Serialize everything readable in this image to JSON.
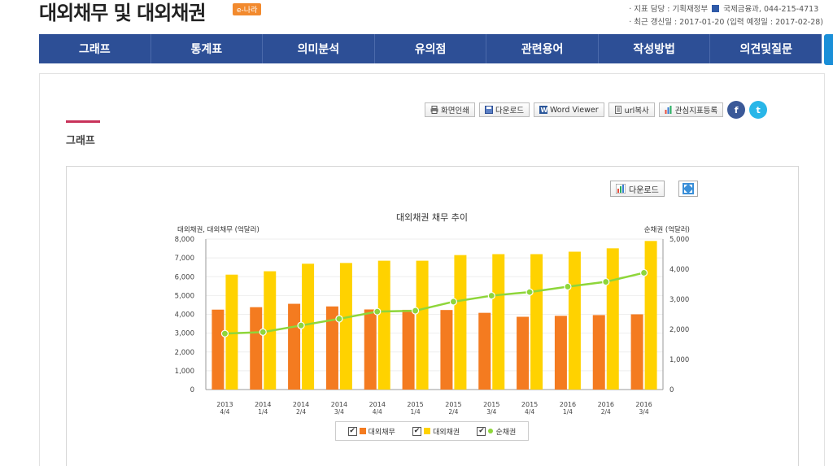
{
  "header": {
    "title": "대외채무 및 대외채권",
    "badge": "e-나라",
    "meta_line1": "· 지표 담당 : 기획재정부",
    "meta_dept": "국제금융과, 044-215-4713",
    "meta_line2": "· 최근 갱신일 : 2017-01-20 (입력 예정일 : 2017-02-28)"
  },
  "nav": [
    "그래프",
    "통계표",
    "의미분석",
    "유의점",
    "관련용어",
    "작성방법",
    "의견및질문"
  ],
  "toolbar": {
    "print": "화면인쇄",
    "download": "다운로드",
    "word": "Word Viewer",
    "url": "url복사",
    "interest": "관심지표등록",
    "facebook": "f",
    "twitter": "t"
  },
  "section": {
    "title": "그래프"
  },
  "chart_controls": {
    "download": "다운로드"
  },
  "colors": {
    "debt": "#f47b20",
    "credit": "#ffd200",
    "net": "#8ed63a",
    "nav": "#2d4f96"
  },
  "chart_data": {
    "type": "bar",
    "title": "대외채권 채무 추이",
    "ylabel_left": "대외채권, 대외채무 (억달러)",
    "ylabel_right": "순채권 (억달러)",
    "ylim_left": [
      0,
      8000
    ],
    "ylim_right": [
      0,
      5000
    ],
    "left_ticks": [
      "0",
      "1,000",
      "2,000",
      "3,000",
      "4,000",
      "5,000",
      "6,000",
      "7,000",
      "8,000"
    ],
    "right_ticks": [
      "0",
      "1,000",
      "2,000",
      "3,000",
      "4,000",
      "5,000"
    ],
    "categories": [
      [
        "2013",
        "4/4"
      ],
      [
        "2014",
        "1/4"
      ],
      [
        "2014",
        "2/4"
      ],
      [
        "2014",
        "3/4"
      ],
      [
        "2014",
        "4/4"
      ],
      [
        "2015",
        "1/4"
      ],
      [
        "2015",
        "2/4"
      ],
      [
        "2015",
        "3/4"
      ],
      [
        "2015",
        "4/4"
      ],
      [
        "2016",
        "1/4"
      ],
      [
        "2016",
        "2/4"
      ],
      [
        "2016",
        "3/4"
      ]
    ],
    "series": [
      {
        "name": "대외채무",
        "type": "bar",
        "axis": "left",
        "values": [
          4250,
          4380,
          4560,
          4420,
          4260,
          4240,
          4230,
          4080,
          3870,
          3920,
          3960,
          4000
        ]
      },
      {
        "name": "대외채권",
        "type": "bar",
        "axis": "left",
        "values": [
          6110,
          6290,
          6690,
          6730,
          6850,
          6850,
          7150,
          7200,
          7200,
          7330,
          7510,
          7900
        ]
      },
      {
        "name": "순채권",
        "type": "line",
        "axis": "right",
        "values": [
          1860,
          1910,
          2130,
          2350,
          2590,
          2620,
          2920,
          3120,
          3240,
          3420,
          3580,
          3880
        ]
      }
    ],
    "grid": true,
    "legend_placement": "bottom-center"
  }
}
